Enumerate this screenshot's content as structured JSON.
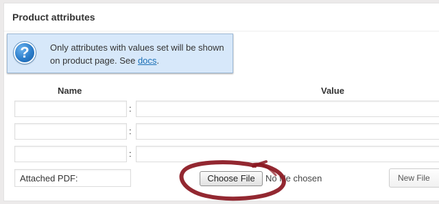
{
  "panel": {
    "title": "Product attributes"
  },
  "notice": {
    "icon": "question-icon",
    "icon_glyph": "?",
    "text": "Only attributes with values set will be shown on product page. See ",
    "link_label": "docs",
    "text_end": "."
  },
  "table": {
    "headers": {
      "name": "Name",
      "value": "Value"
    },
    "separator": ":",
    "rows": [
      {
        "name": "",
        "value": ""
      },
      {
        "name": "",
        "value": ""
      },
      {
        "name": "",
        "value": ""
      }
    ]
  },
  "attachment": {
    "name": "Attached PDF:",
    "choose_label": "Choose File",
    "no_file_text": "No file chosen",
    "new_file_label": "New File"
  },
  "colors": {
    "notice_bg": "#d7e8fa",
    "link": "#1a6fb5",
    "highlight": "#8a1620"
  }
}
